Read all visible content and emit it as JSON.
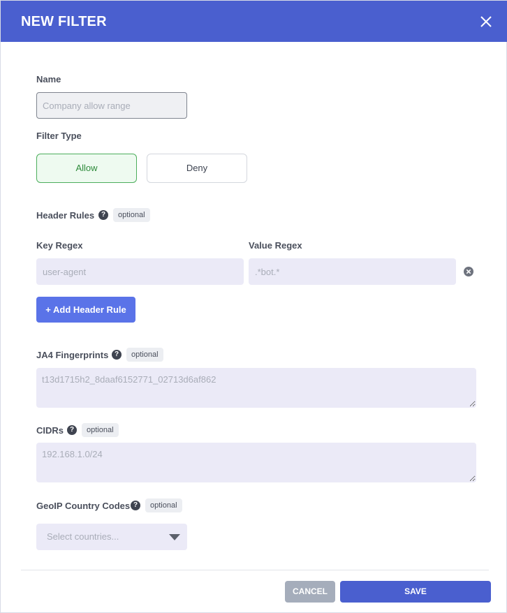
{
  "dialog": {
    "title": "NEW FILTER",
    "close_icon": "close-icon"
  },
  "name": {
    "label": "Name",
    "placeholder": "Company allow range",
    "value": ""
  },
  "filter_type": {
    "label": "Filter Type",
    "options": [
      "Allow",
      "Deny"
    ],
    "selected": "Allow"
  },
  "header_rules": {
    "label": "Header Rules",
    "help_icon": "?",
    "badge": "optional",
    "key_label": "Key Regex",
    "value_label": "Value Regex",
    "key_placeholder": "user-agent",
    "value_placeholder": ".*bot.*",
    "add_button": "+ Add Header Rule"
  },
  "ja4": {
    "label": "JA4 Fingerprints",
    "help_icon": "?",
    "badge": "optional",
    "placeholder": "t13d1715h2_8daaf6152771_02713d6af862"
  },
  "cidrs": {
    "label": "CIDRs",
    "help_icon": "?",
    "badge": "optional",
    "placeholder": "192.168.1.0/24"
  },
  "geoip": {
    "label": "GeoIP Country Codes",
    "help_icon": "?",
    "badge": "optional",
    "placeholder": "Select countries..."
  },
  "footer": {
    "cancel": "CANCEL",
    "save": "SAVE"
  },
  "colors": {
    "header": "#4a5fcf",
    "allow_border": "#4cae5c",
    "add_button": "#5a73e8",
    "cancel_button": "#a5adbb",
    "save_button": "#4a5fcf"
  }
}
